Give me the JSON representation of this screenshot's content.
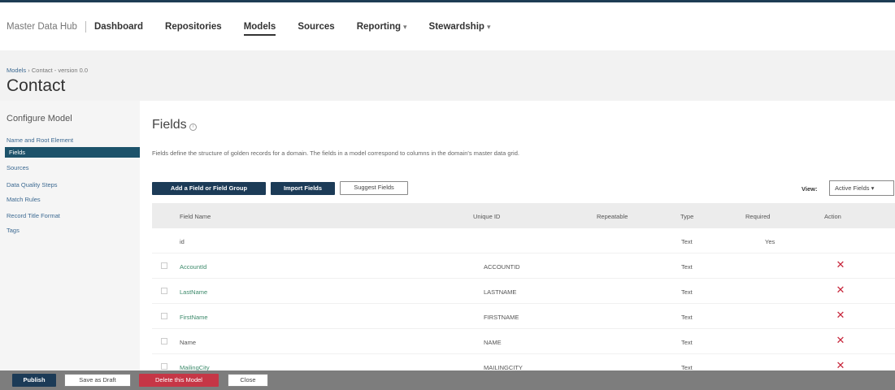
{
  "nav": {
    "brand": "Master Data Hub",
    "items": [
      {
        "label": "Dashboard",
        "caret": ""
      },
      {
        "label": "Repositories",
        "caret": ""
      },
      {
        "label": "Models",
        "caret": ""
      },
      {
        "label": "Sources",
        "caret": ""
      },
      {
        "label": "Reporting",
        "caret": "▾"
      },
      {
        "label": "Stewardship",
        "caret": "▾"
      }
    ]
  },
  "breadcrumb": {
    "link": "Models",
    "separator": " › ",
    "rest": "Contact - version 0.0"
  },
  "page": {
    "title": "Contact"
  },
  "sidebar": {
    "heading": "Configure Model",
    "items": [
      "Name and Root Element",
      "Fields",
      "Sources",
      "Data Quality Steps",
      "Match Rules",
      "Record Title Format",
      "Tags"
    ],
    "selected": "Fields"
  },
  "fields": {
    "title": "Fields",
    "info_icon": "i",
    "description": "Fields define the structure of golden records for a domain. The fields in a model correspond to columns in the domain's master data grid.",
    "buttons": {
      "add": "Add a Field or Field Group",
      "import": "Import Fields",
      "suggest": "Suggest Fields"
    },
    "view_label": "View:",
    "view_value": "Active Fields ▾"
  },
  "table": {
    "columns": [
      "Field Name",
      "Unique ID",
      "Repeatable",
      "Type",
      "Required",
      "Action"
    ],
    "rows": [
      {
        "name": "id",
        "unique_id": "",
        "type": "Text",
        "required": "Yes",
        "link": false,
        "checkbox": false,
        "delete": false
      },
      {
        "name": "AccountId",
        "unique_id": "ACCOUNTID",
        "type": "Text",
        "required": "",
        "link": true,
        "checkbox": true,
        "delete": true
      },
      {
        "name": "LastName",
        "unique_id": "LASTNAME",
        "type": "Text",
        "required": "",
        "link": true,
        "checkbox": true,
        "delete": true
      },
      {
        "name": "FirstName",
        "unique_id": "FIRSTNAME",
        "type": "Text",
        "required": "",
        "link": true,
        "checkbox": true,
        "delete": true
      },
      {
        "name": "Name",
        "unique_id": "NAME",
        "type": "Text",
        "required": "",
        "link": false,
        "checkbox": true,
        "delete": true
      },
      {
        "name": "MailingCity",
        "unique_id": "MAILINGCITY",
        "type": "Text",
        "required": "",
        "link": true,
        "checkbox": true,
        "delete": true
      }
    ]
  },
  "footer": {
    "publish": "Publish",
    "save_draft": "Save as Draft",
    "delete_model": "Delete this Model",
    "close": "Close"
  },
  "colors": {
    "brand": "#1c3b57",
    "selected": "#1c526a",
    "danger": "#c63646",
    "link": "#3d6a92",
    "delete_icon": "#c7253a"
  }
}
